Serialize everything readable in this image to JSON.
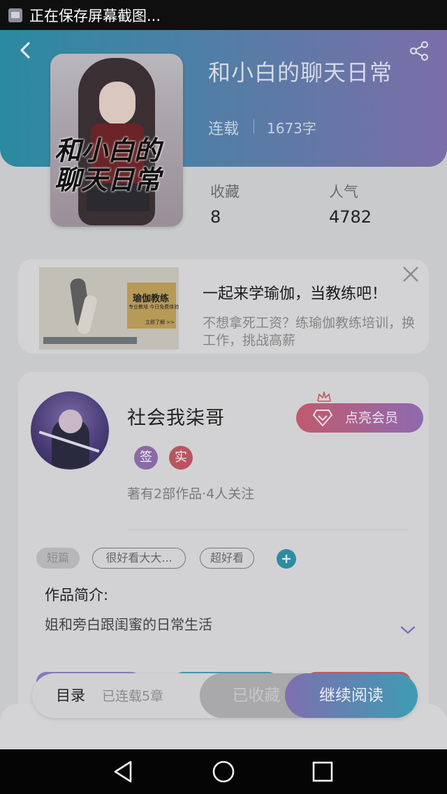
{
  "status_bar": {
    "notification_text": "正在保存屏幕截图..."
  },
  "book": {
    "title": "和小白的聊天日常",
    "status": "连载",
    "word_count": "1673字",
    "cover_title": "和小白的聊天日常"
  },
  "stats": {
    "favorites_label": "收藏",
    "favorites_value": "8",
    "popularity_label": "人气",
    "popularity_value": "4782"
  },
  "ad": {
    "image_title": "瑜伽教练",
    "image_subtitle": "专业教培  今日免费体验",
    "image_cta": "立即了解 >>",
    "title": "一起来学瑜伽，当教练吧！",
    "description": "不想拿死工资？练瑜伽教练培训，换工作，挑战高薪"
  },
  "author": {
    "name": "社会我柒哥",
    "badges": [
      {
        "label": "签",
        "color": "#8a6aa6"
      },
      {
        "label": "实",
        "color": "#b85560"
      }
    ],
    "meta": "著有2部作品·4人关注",
    "vip_button": "点亮会员"
  },
  "tags": [
    "短篇",
    "很好看大大...",
    "超好看"
  ],
  "intro": {
    "label": "作品简介:",
    "text": "姐和旁白跟闺蜜的日常生活"
  },
  "bottom_bar": {
    "toc_label": "目录",
    "toc_count": "已连载5章",
    "collected_button": "已收藏",
    "read_button": "继续阅读"
  },
  "colors": {
    "hero_gradient_start": "#2a8aa0",
    "hero_gradient_end": "#7b6ea8",
    "accent_teal": "#3f9cb2",
    "accent_purple": "#7e6fb0"
  }
}
